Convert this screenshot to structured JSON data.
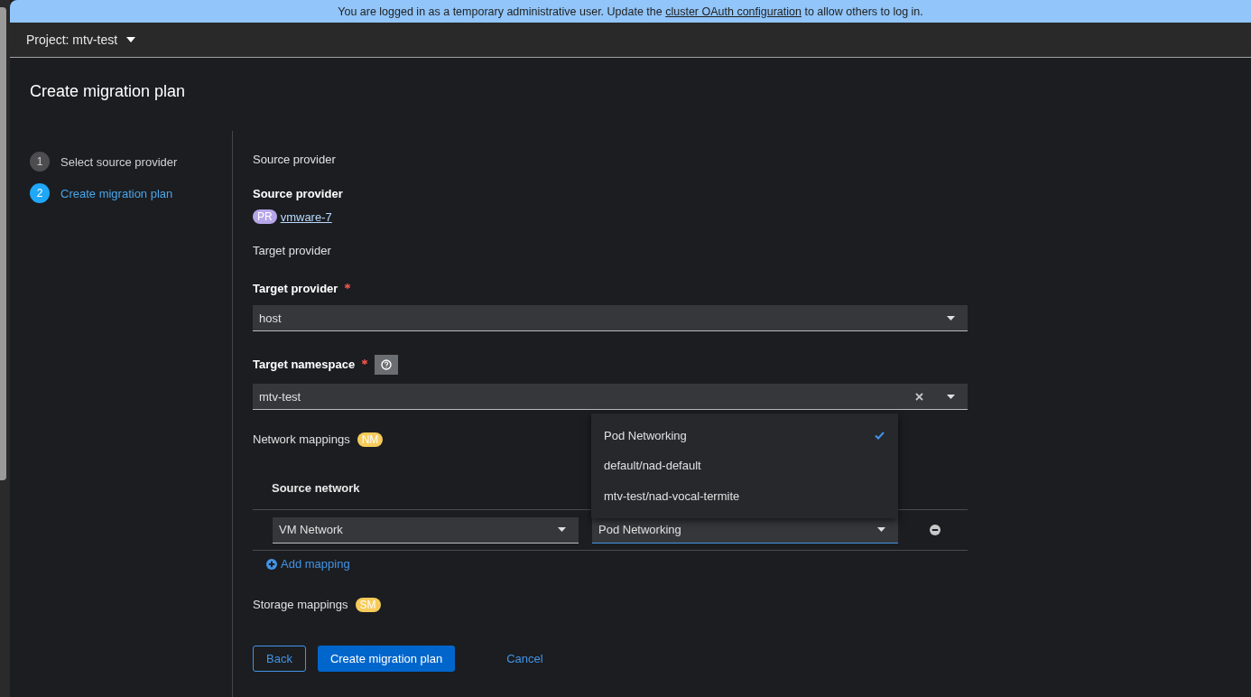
{
  "banner": {
    "before": "You are logged in as a temporary administrative user. Update the",
    "link": "cluster OAuth configuration",
    "after": "to allow others to log in."
  },
  "project": {
    "label": "Project: mtv-test"
  },
  "page_title": "Create migration plan",
  "wizard_steps": [
    {
      "number": "1",
      "label": "Select source provider",
      "selected": false
    },
    {
      "number": "2",
      "label": "Create migration plan",
      "selected": true
    }
  ],
  "source_section": {
    "heading": "Source provider",
    "label": "Source provider",
    "badge": "PR",
    "link": "vmware-7"
  },
  "target_section": {
    "heading": "Target provider",
    "fields": [
      {
        "label": "Target provider",
        "required": true,
        "help": false,
        "value": "host",
        "clearable": false
      },
      {
        "label": "Target namespace",
        "required": true,
        "help": true,
        "value": "mtv-test",
        "clearable": true
      }
    ]
  },
  "network_mappings": {
    "label": "Network mappings",
    "badge": "NM",
    "column_1": "Source network",
    "rows": [
      {
        "source": "VM Network",
        "target": "Pod Networking"
      }
    ],
    "add_label": "Add mapping",
    "menu": [
      {
        "label": "Pod Networking",
        "selected": true
      },
      {
        "label": "default/nad-default",
        "selected": false
      },
      {
        "label": "mtv-test/nad-vocal-termite",
        "selected": false
      }
    ]
  },
  "storage_mappings": {
    "label": "Storage mappings",
    "badge": "SM"
  },
  "buttons": [
    {
      "label": "Back",
      "kind": "secondary"
    },
    {
      "label": "Create migration plan",
      "kind": "primary"
    },
    {
      "label": "Cancel",
      "kind": "link"
    }
  ]
}
